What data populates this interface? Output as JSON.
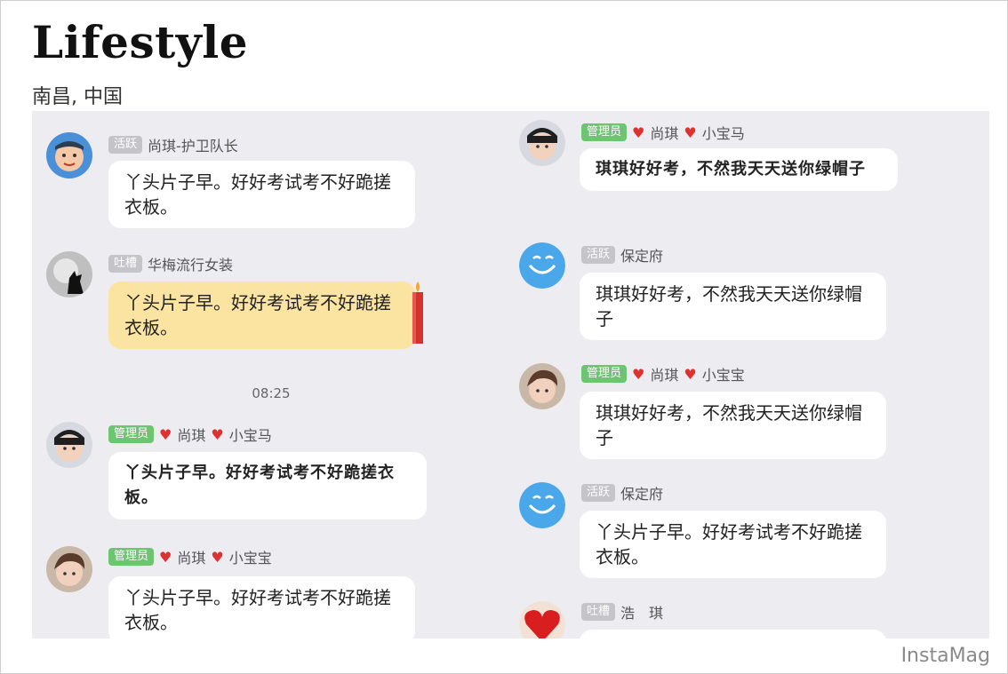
{
  "header": {
    "title": "Lifestyle",
    "location": "南昌, 中国"
  },
  "watermark": "InstaMag",
  "colors": {
    "chat_background": "#ededf1",
    "badge_grey": "#c5c5c9",
    "badge_admin": "#6cc56f",
    "special_bubble": "#fbe4a2",
    "heart": "#e03131"
  },
  "left_column": {
    "time_divider": "08:25",
    "messages": [
      {
        "badge": "活跃",
        "badge_color": "grey",
        "sender": "尚琪-护卫队长",
        "hearts": false,
        "text": "丫头片子早。好好考试考不好跪搓衣板。",
        "avatar_icon": "baby-avatar-icon"
      },
      {
        "badge": "吐槽",
        "badge_color": "grey",
        "sender": "华梅流行女装",
        "hearts": false,
        "text": "丫头片子早。好好考试考不好跪搓衣板。",
        "bubble_style": "candle",
        "avatar_icon": "wolf-moon-avatar-icon"
      },
      {
        "badge": "管理员",
        "badge_color": "green",
        "sender_part1": "尚琪",
        "sender_part2": "小宝马",
        "hearts": true,
        "text": "丫头片子早。好好考试考不好跪搓衣板。",
        "bubble_style": "handwriting",
        "avatar_icon": "boy-avatar-icon"
      },
      {
        "badge": "管理员",
        "badge_color": "green",
        "sender_part1": "尚琪",
        "sender_part2": "小宝宝",
        "hearts": true,
        "text": "丫头片子早。好好考试考不好跪搓衣板。",
        "avatar_icon": "young-man-avatar-icon"
      }
    ]
  },
  "right_column": {
    "messages": [
      {
        "badge": "管理员",
        "badge_color": "green",
        "sender_part1": "尚琪",
        "sender_part2": "小宝马",
        "hearts": true,
        "text": "琪琪好好考，不然我天天送你绿帽子",
        "bubble_style": "handwriting",
        "avatar_icon": "boy-avatar-icon"
      },
      {
        "badge": "活跃",
        "badge_color": "grey",
        "sender": "保定府",
        "hearts": false,
        "text": "琪琪好好考，不然我天天送你绿帽子",
        "avatar_icon": "blue-smile-avatar-icon"
      },
      {
        "badge": "管理员",
        "badge_color": "green",
        "sender_part1": "尚琪",
        "sender_part2": "小宝宝",
        "hearts": true,
        "text": "琪琪好好考，不然我天天送你绿帽子",
        "avatar_icon": "young-man-avatar-icon"
      },
      {
        "badge": "活跃",
        "badge_color": "grey",
        "sender": "保定府",
        "hearts": false,
        "text": "丫头片子早。好好考试考不好跪搓衣板。",
        "avatar_icon": "blue-smile-avatar-icon"
      },
      {
        "badge": "吐槽",
        "badge_color": "grey",
        "sender": "浩　琪",
        "hearts": false,
        "text": "",
        "avatar_icon": "red-heart-avatar-icon"
      }
    ]
  }
}
